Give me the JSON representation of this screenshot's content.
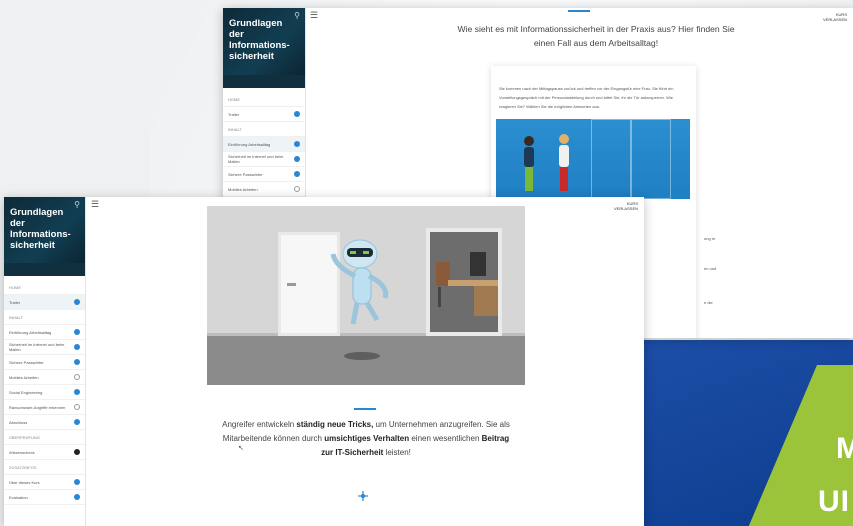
{
  "course_title": "Grundlagen der Informations-sicherheit",
  "exit_label": "KURS VERLASSEN",
  "back_window": {
    "heading": "Wie sieht es mit Informationssicherheit in der Praxis aus? Hier finden Sie einen Fall aus dem Arbeitsalltag!",
    "card_text": "Sie kommen nach der Mittagspause zurück und treffen vor der Eingangstür eine Frau. Sie führt ein Vorstellungsgespräch mit der Personalabteilung durch und bittet Sie, ihr die Tür aufzusperren. Wie reagieren Sie? Wählen Sie die möglichen Antworten aus.",
    "sidebar": [
      {
        "label": "HOME",
        "section": true
      },
      {
        "label": "Trailer",
        "status": "done"
      },
      {
        "label": "INHALT",
        "section": true
      },
      {
        "label": "Einführung Arbeitsalltag",
        "status": "done",
        "active": true
      },
      {
        "label": "Sicherheit im Internet und beim Mailen",
        "status": "done"
      },
      {
        "label": "Sichere Passwörter",
        "status": "done"
      },
      {
        "label": "Mobiles Arbeiten",
        "status": "open"
      }
    ]
  },
  "front_window": {
    "message_parts": [
      "Angreifer entwickeln ",
      "ständig neue Tricks,",
      " um Unternehmen anzugreifen. Sie als Mitarbeitende können durch ",
      "umsichtiges Verhalten",
      " einen wesentlichen ",
      "Beitrag zur IT-Sicherheit",
      " leisten!"
    ],
    "sidebar": [
      {
        "label": "HOME",
        "section": true
      },
      {
        "label": "Trailer",
        "status": "done",
        "active": true
      },
      {
        "label": "INHALT",
        "section": true
      },
      {
        "label": "Einführung Arbeitsalltag",
        "status": "done"
      },
      {
        "label": "Sicherheit im Internet und beim Mailen",
        "status": "done"
      },
      {
        "label": "Sichere Passwörter",
        "status": "done"
      },
      {
        "label": "Mobiles Arbeiten",
        "status": "open"
      },
      {
        "label": "Social Engineering",
        "status": "done"
      },
      {
        "label": "Ransomware-Angriffe erkennen",
        "status": "open"
      },
      {
        "label": "Abschluss",
        "status": "done"
      },
      {
        "label": "ÜBERPRÜFUNG",
        "section": true
      },
      {
        "label": "Wissenscheck",
        "status": "dark"
      },
      {
        "label": "ZUSATZINFOS",
        "section": true
      },
      {
        "label": "Über dieses Kurs",
        "status": "done"
      },
      {
        "label": "Evaluation",
        "status": "done"
      }
    ]
  },
  "colors": {
    "accent": "#2a86d1",
    "sidebar_header": "#123e52",
    "promo_blue": "#0c3d8f",
    "promo_green": "#9bc43a"
  }
}
